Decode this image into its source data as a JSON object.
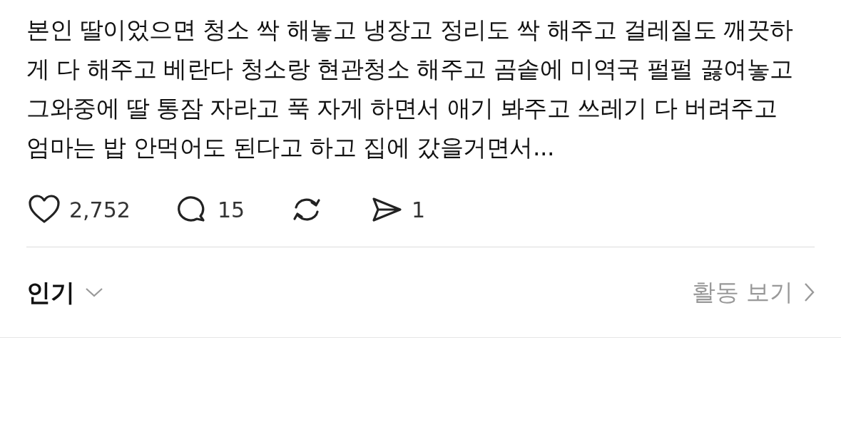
{
  "post": {
    "text": "본인 딸이었으면 청소 싹 해놓고 냉장고 정리도 싹 해주고 걸레질도 깨끗하게 다 해주고 베란다 청소랑 현관청소 해주고 곰솥에 미역국 펄펄 끓여놓고 그와중에 딸 통잠 자라고 푹 자게 하면서 애기 봐주고 쓰레기 다 버려주고 엄마는 밥 안먹어도 된다고 하고 집에 갔을거면서..."
  },
  "actions": [
    {
      "kind": "like",
      "count": "2,752"
    },
    {
      "kind": "comment",
      "count": "15"
    },
    {
      "kind": "repost"
    },
    {
      "kind": "share",
      "count": "1"
    }
  ],
  "sort": {
    "label": "인기"
  },
  "activity_link": {
    "label": "활동 보기"
  }
}
